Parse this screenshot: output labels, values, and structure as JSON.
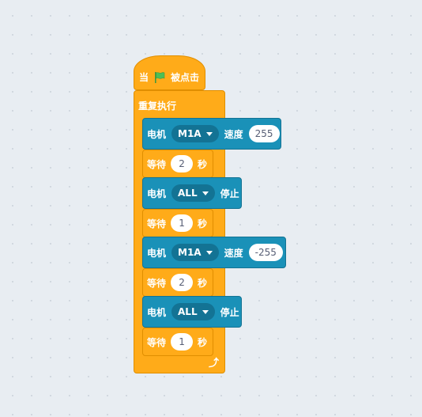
{
  "script": {
    "hat": {
      "prefix": "当",
      "suffix": "被点击"
    },
    "loop": {
      "label": "重复执行"
    },
    "blocks": [
      {
        "type": "motor",
        "label": "电机",
        "port": "M1A",
        "action": "速度",
        "value": "255"
      },
      {
        "type": "wait",
        "label": "等待",
        "value": "2",
        "unit": "秒"
      },
      {
        "type": "motor",
        "label": "电机",
        "port": "ALL",
        "action": "停止"
      },
      {
        "type": "wait",
        "label": "等待",
        "value": "1",
        "unit": "秒"
      },
      {
        "type": "motor",
        "label": "电机",
        "port": "M1A",
        "action": "速度",
        "value": "-255"
      },
      {
        "type": "wait",
        "label": "等待",
        "value": "2",
        "unit": "秒"
      },
      {
        "type": "motor",
        "label": "电机",
        "port": "ALL",
        "action": "停止"
      },
      {
        "type": "wait",
        "label": "等待",
        "value": "1",
        "unit": "秒"
      }
    ]
  },
  "colors": {
    "event": "#ffab19",
    "motor": "#1a91b8",
    "motor_dark": "#137394",
    "flag": "#4cbf56"
  },
  "icons": {
    "flag": "green-flag-icon",
    "loop_end": "loop-arrow-icon"
  }
}
